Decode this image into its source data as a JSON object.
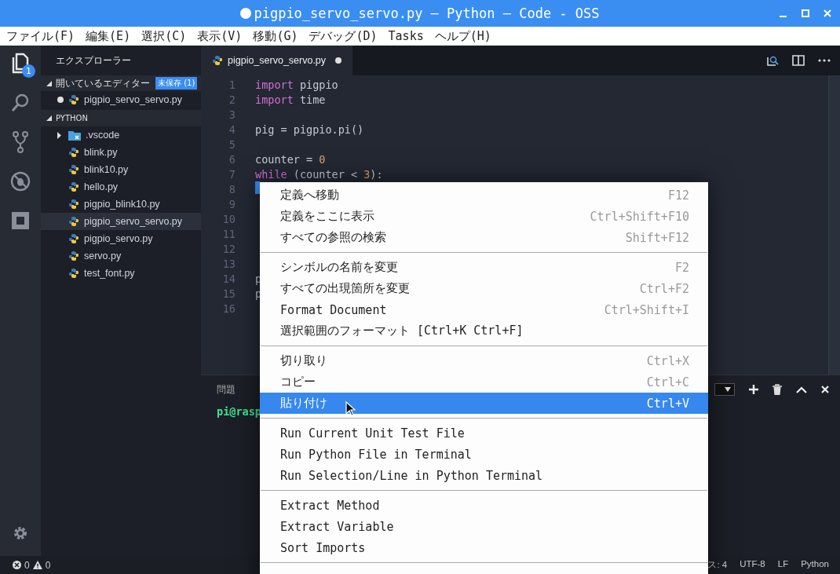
{
  "window": {
    "title": "pigpio_servo_servo.py — Python — Code - OSS",
    "modified": true
  },
  "menubar": [
    "ファイル(F)",
    "編集(E)",
    "選択(C)",
    "表示(V)",
    "移動(G)",
    "デバッグ(D)",
    "Tasks",
    "ヘルプ(H)"
  ],
  "activity_bar": {
    "explorer_badge": "1"
  },
  "sidebar": {
    "title": "エクスプローラー",
    "open_editors": {
      "title": "開いているエディター",
      "badge": "未保存 (1)",
      "expanded": true,
      "items": [
        {
          "name": "pigpio_servo_servo.py",
          "modified": true
        }
      ]
    },
    "folder": {
      "title": "PYTHON",
      "expanded": true,
      "items": [
        {
          "name": ".vscode",
          "kind": "folder",
          "expanded": false,
          "selected": false
        },
        {
          "name": "blink.py",
          "kind": "python",
          "selected": false
        },
        {
          "name": "blink10.py",
          "kind": "python",
          "selected": false
        },
        {
          "name": "hello.py",
          "kind": "python",
          "selected": false
        },
        {
          "name": "pigpio_blink10.py",
          "kind": "python",
          "selected": false
        },
        {
          "name": "pigpio_servo_servo.py",
          "kind": "python",
          "selected": true
        },
        {
          "name": "pigpio_servo.py",
          "kind": "python",
          "selected": false
        },
        {
          "name": "servo.py",
          "kind": "python",
          "selected": false
        },
        {
          "name": "test_font.py",
          "kind": "python",
          "selected": false
        }
      ]
    }
  },
  "editor": {
    "tab": {
      "name": "pigpio_servo_servo.py",
      "modified": true
    },
    "lines": [
      {
        "number": "1",
        "tokens": [
          {
            "text": "import",
            "kind": "keyword"
          },
          {
            "text": " pigpio",
            "kind": "plain"
          }
        ]
      },
      {
        "number": "2",
        "tokens": [
          {
            "text": "import",
            "kind": "keyword"
          },
          {
            "text": " time",
            "kind": "plain"
          }
        ]
      },
      {
        "number": "3"
      },
      {
        "number": "4",
        "tokens": [
          {
            "text": "pig = pigpio.pi()",
            "kind": "plain"
          }
        ]
      },
      {
        "number": "5"
      },
      {
        "number": "6",
        "tokens": [
          {
            "text": "counter = ",
            "kind": "plain"
          },
          {
            "text": "0",
            "kind": "number"
          }
        ]
      },
      {
        "number": "7",
        "tokens": [
          {
            "text": "while",
            "kind": "keyword"
          },
          {
            "text": " (counter < ",
            "kind": "plain"
          },
          {
            "text": "3",
            "kind": "number"
          },
          {
            "text": "):",
            "kind": "plain"
          }
        ]
      },
      {
        "number": "8"
      },
      {
        "number": "9"
      },
      {
        "number": "10"
      },
      {
        "number": "11"
      },
      {
        "number": "12"
      },
      {
        "number": "13"
      },
      {
        "number": "14",
        "tokens": [
          {
            "text": "p",
            "kind": "plain"
          }
        ]
      },
      {
        "number": "15",
        "tokens": [
          {
            "text": "p",
            "kind": "plain"
          }
        ]
      },
      {
        "number": "16"
      }
    ]
  },
  "panel": {
    "tab": "問題",
    "terminal_text": "pi@rasp"
  },
  "context_menu": [
    {
      "kind": "item",
      "label": "定義へ移動",
      "shortcut": "F12",
      "selected": false
    },
    {
      "kind": "item",
      "label": "定義をここに表示",
      "shortcut": "Ctrl+Shift+F10",
      "selected": false
    },
    {
      "kind": "item",
      "label": "すべての参照の検索",
      "shortcut": "Shift+F12",
      "selected": false
    },
    {
      "kind": "separator"
    },
    {
      "kind": "item",
      "label": "シンボルの名前を変更",
      "shortcut": "F2",
      "selected": false
    },
    {
      "kind": "item",
      "label": "すべての出現箇所を変更",
      "shortcut": "Ctrl+F2",
      "selected": false
    },
    {
      "kind": "item",
      "label": "Format Document",
      "shortcut": "Ctrl+Shift+I",
      "selected": false
    },
    {
      "kind": "item",
      "label": "選択範囲のフォーマット [Ctrl+K Ctrl+F]",
      "selected": false
    },
    {
      "kind": "separator"
    },
    {
      "kind": "item",
      "label": "切り取り",
      "shortcut": "Ctrl+X",
      "selected": false
    },
    {
      "kind": "item",
      "label": "コピー",
      "shortcut": "Ctrl+C",
      "selected": false
    },
    {
      "kind": "item",
      "label": "貼り付け",
      "shortcut": "Ctrl+V",
      "selected": true
    },
    {
      "kind": "separator"
    },
    {
      "kind": "item",
      "label": "Run Current Unit Test File",
      "selected": false
    },
    {
      "kind": "item",
      "label": "Run Python File in Terminal",
      "selected": false
    },
    {
      "kind": "item",
      "label": "Run Selection/Line in Python Terminal",
      "selected": false
    },
    {
      "kind": "separator"
    },
    {
      "kind": "item",
      "label": "Extract Method",
      "selected": false
    },
    {
      "kind": "item",
      "label": "Extract Variable",
      "selected": false
    },
    {
      "kind": "item",
      "label": "Sort Imports",
      "selected": false
    },
    {
      "kind": "separator"
    }
  ],
  "status_bar": {
    "errors": "0",
    "warnings": "0",
    "right": [
      "ス: 4",
      "UTF-8",
      "LF",
      "Python"
    ]
  }
}
